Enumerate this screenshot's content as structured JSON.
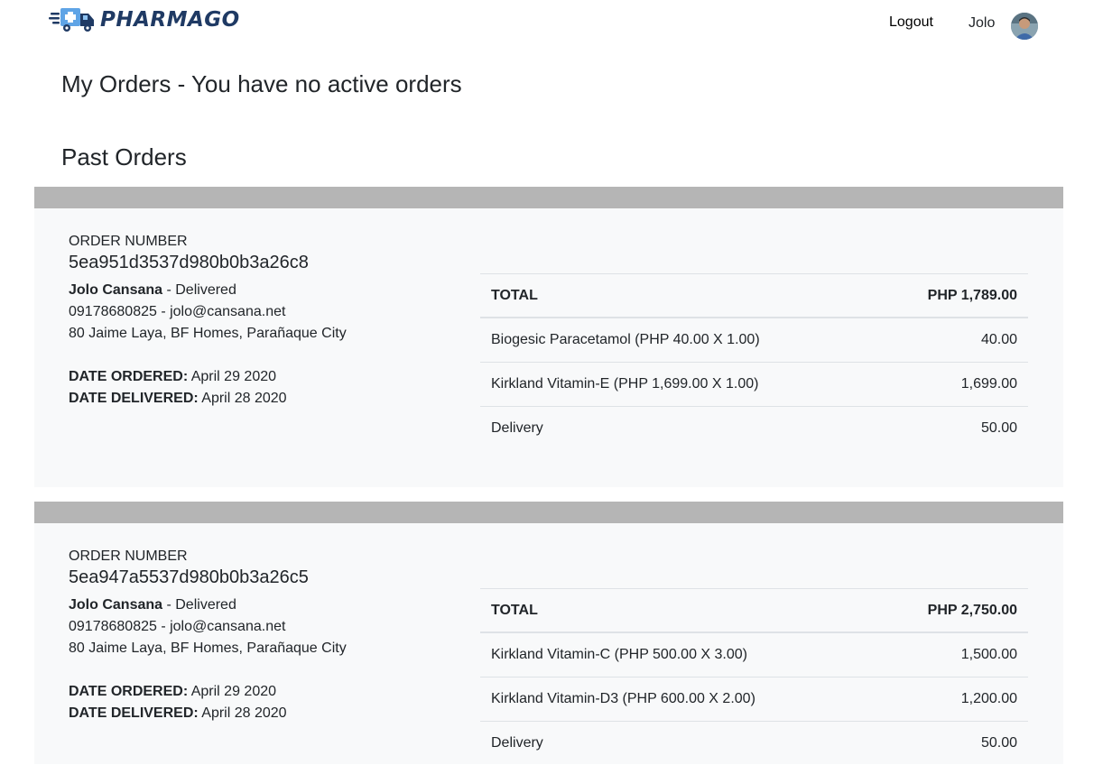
{
  "nav": {
    "brand": "PHARMAGO",
    "logout_label": "Logout",
    "username": "Jolo"
  },
  "page": {
    "heading": "My Orders - You have no active orders",
    "past_orders_heading": "Past Orders"
  },
  "labels": {
    "order_number": "ORDER NUMBER",
    "date_ordered": "DATE ORDERED:",
    "date_delivered": "DATE DELIVERED:",
    "total": "TOTAL"
  },
  "orders": [
    {
      "id": "5ea951d3537d980b0b3a26c8",
      "customer": "Jolo Cansana",
      "status": " - Delivered",
      "contact": "09178680825 - jolo@cansana.net",
      "address": "80 Jaime Laya, BF Homes, Parañaque City",
      "date_ordered": "April 29 2020",
      "date_delivered": "April 28 2020",
      "total": "PHP 1,789.00",
      "items": [
        {
          "name": "Biogesic Paracetamol (PHP 40.00 X 1.00)",
          "amount": "40.00"
        },
        {
          "name": "Kirkland Vitamin-E (PHP 1,699.00 X 1.00)",
          "amount": "1,699.00"
        },
        {
          "name": "Delivery",
          "amount": "50.00"
        }
      ]
    },
    {
      "id": "5ea947a5537d980b0b3a26c5",
      "customer": "Jolo Cansana",
      "status": " - Delivered",
      "contact": "09178680825 - jolo@cansana.net",
      "address": "80 Jaime Laya, BF Homes, Parañaque City",
      "date_ordered": "April 29 2020",
      "date_delivered": "April 28 2020",
      "total": "PHP 2,750.00",
      "items": [
        {
          "name": "Kirkland Vitamin-C (PHP 500.00 X 3.00)",
          "amount": "1,500.00"
        },
        {
          "name": "Kirkland Vitamin-D3 (PHP 600.00 X 2.00)",
          "amount": "1,200.00"
        },
        {
          "name": "Delivery",
          "amount": "50.00"
        }
      ]
    }
  ],
  "colors": {
    "brand": "#1f3a64",
    "card_bg": "#f8f9fa",
    "card_bar": "#b5b5b5"
  },
  "icons": [
    "delivery-truck-logo-icon",
    "user-avatar"
  ]
}
